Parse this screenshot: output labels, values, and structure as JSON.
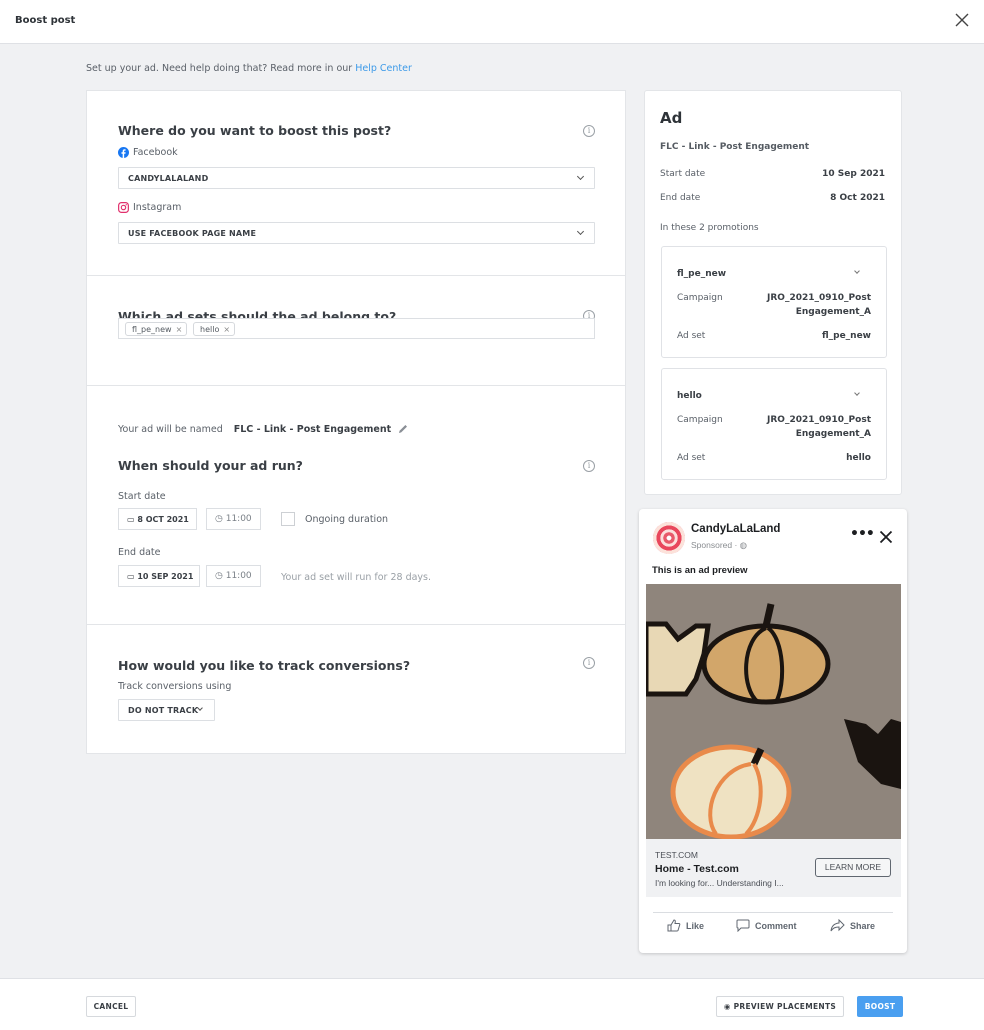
{
  "header": {
    "title": "Boost post",
    "close_icon": "close-icon"
  },
  "intro": {
    "text": "Set up your ad. Need help doing that? Read more in our ",
    "link": "Help Center"
  },
  "placement": {
    "heading": "Where do you want to boost this post?",
    "facebook_label": "Facebook",
    "facebook_value": "CANDYLALALAND",
    "instagram_label": "Instagram",
    "instagram_value": "USE FACEBOOK PAGE NAME"
  },
  "adsets": {
    "heading": "Which ad sets should the ad belong to?",
    "tags": [
      "fl_pe_new",
      "hello"
    ],
    "remove_glyph": "×"
  },
  "schedule": {
    "name_label": "Your ad will be named",
    "name_value": "FLC - Link - Post Engagement",
    "heading": "When should your ad run?",
    "start_label": "Start date",
    "start_date": "8 OCT 2021",
    "start_time": "11:00",
    "ongoing_label": "Ongoing duration",
    "ongoing_checked": false,
    "end_label": "End date",
    "end_date": "10 SEP 2021",
    "end_time": "11:00",
    "duration_note": "Your ad set will run for 28 days."
  },
  "conversions": {
    "heading": "How would you like to track conversions?",
    "label": "Track conversions using",
    "value": "DO NOT TRACK"
  },
  "summary": {
    "title": "Ad",
    "ad_name": "FLC - Link - Post Engagement",
    "start_label": "Start date",
    "start_value": "10 Sep 2021",
    "end_label": "End date",
    "end_value": "8 Oct 2021",
    "promotions_label": "In these 2 promotions",
    "promotions": [
      {
        "name": "fl_pe_new",
        "campaign_label": "Campaign",
        "campaign_line1": "JRO_2021_0910_Post",
        "campaign_line2": "Engagement_A",
        "adset_label": "Ad set",
        "adset_value": "fl_pe_new"
      },
      {
        "name": "hello",
        "campaign_label": "Campaign",
        "campaign_line1": "JRO_2021_0910_Post",
        "campaign_line2": "Engagement_A",
        "adset_label": "Ad set",
        "adset_value": "hello"
      }
    ]
  },
  "preview": {
    "page_name": "CandyLaLaLand",
    "sponsored": "Sponsored · ",
    "globe_glyph": "◍",
    "more_glyph": "•••",
    "text": "This is an ad preview",
    "domain": "TEST.COM",
    "link_title": "Home - Test.com",
    "link_desc": "I'm looking for... Understanding I...",
    "cta": "LEARN MORE",
    "actions": {
      "like": "Like",
      "comment": "Comment",
      "share": "Share"
    }
  },
  "footer": {
    "cancel": "CANCEL",
    "preview_placements": "PREVIEW PLACEMENTS",
    "boost": "BOOST"
  },
  "colors": {
    "accent": "#4a9ff0",
    "link": "#3d9ae8",
    "facebook": "#1877f2",
    "instagram": "#e1306c"
  }
}
